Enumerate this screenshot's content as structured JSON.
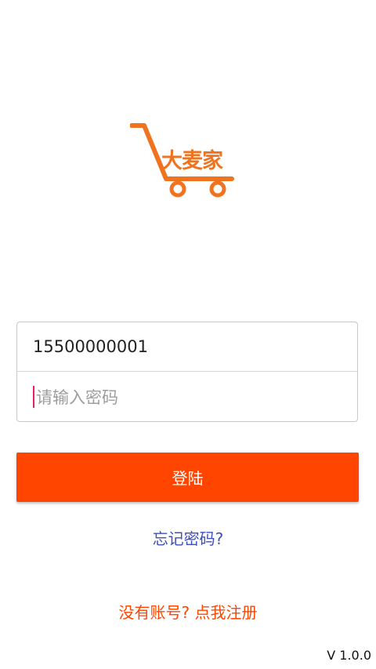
{
  "logo": {
    "text": "大麦家",
    "color": "#f0731f"
  },
  "form": {
    "phone_value": "15500000001",
    "password_placeholder": "请输入密码"
  },
  "login_button": {
    "label": "登陆",
    "color": "#ff4500"
  },
  "forgot_password": {
    "label": "忘记密码?",
    "color": "#3f51b5"
  },
  "register": {
    "label": "没有账号? 点我注册",
    "color": "#ff4500"
  },
  "version": "V 1.0.0"
}
